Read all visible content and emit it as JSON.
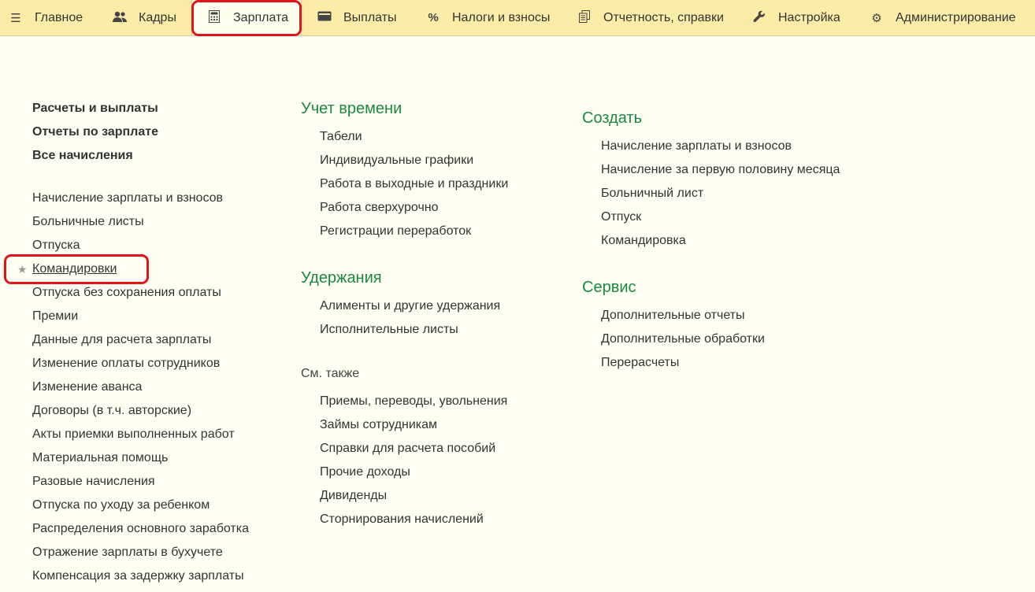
{
  "topbar": {
    "tabs": [
      {
        "label": "Главное",
        "icon": "menu-icon"
      },
      {
        "label": "Кадры",
        "icon": "people-icon"
      },
      {
        "label": "Зарплата",
        "icon": "calculator-icon"
      },
      {
        "label": "Выплаты",
        "icon": "wallet-icon"
      },
      {
        "label": "Налоги и взносы",
        "icon": "percent-icon"
      },
      {
        "label": "Отчетность, справки",
        "icon": "documents-icon"
      },
      {
        "label": "Настройка",
        "icon": "wrench-icon"
      },
      {
        "label": "Администрирование",
        "icon": "gear-icon"
      }
    ],
    "active_tab": "Зарплата"
  },
  "left": {
    "bold_links": [
      "Расчеты и выплаты",
      "Отчеты по зарплате",
      "Все начисления"
    ],
    "links": [
      "Начисление зарплаты и взносов",
      "Больничные листы",
      "Отпуска",
      "Командировки",
      "Отпуска без сохранения оплаты",
      "Премии",
      "Данные для расчета зарплаты",
      "Изменение оплаты сотрудников",
      "Изменение аванса",
      "Договоры (в т.ч. авторские)",
      "Акты приемки выполненных работ",
      "Материальная помощь",
      "Разовые начисления",
      "Отпуска по уходу за ребенком",
      "Распределения основного заработка",
      "Отражение зарплаты в бухучете",
      "Компенсация за задержку зарплаты"
    ],
    "starred": "Командировки"
  },
  "middle": {
    "time_heading": "Учет времени",
    "time_links": [
      "Табели",
      "Индивидуальные графики",
      "Работа в выходные и праздники",
      "Работа сверхурочно",
      "Регистрации переработок"
    ],
    "deductions_heading": "Удержания",
    "deductions_links": [
      "Алименты и другие удержания",
      "Исполнительные листы"
    ],
    "see_also_heading": "См. также",
    "see_also_links": [
      "Приемы, переводы, увольнения",
      "Займы сотрудникам",
      "Справки для расчета пособий",
      "Прочие доходы",
      "Дивиденды",
      "Сторнирования начислений"
    ]
  },
  "right": {
    "create_heading": "Создать",
    "create_links": [
      "Начисление зарплаты и взносов",
      "Начисление за первую половину месяца",
      "Больничный лист",
      "Отпуск",
      "Командировка"
    ],
    "service_heading": "Сервис",
    "service_links": [
      "Дополнительные отчеты",
      "Дополнительные обработки",
      "Перерасчеты"
    ]
  },
  "colors": {
    "topbar": "#fbeca8",
    "background": "#fffff3",
    "heading": "#1a8a3f",
    "highlight": "#e0151a"
  }
}
